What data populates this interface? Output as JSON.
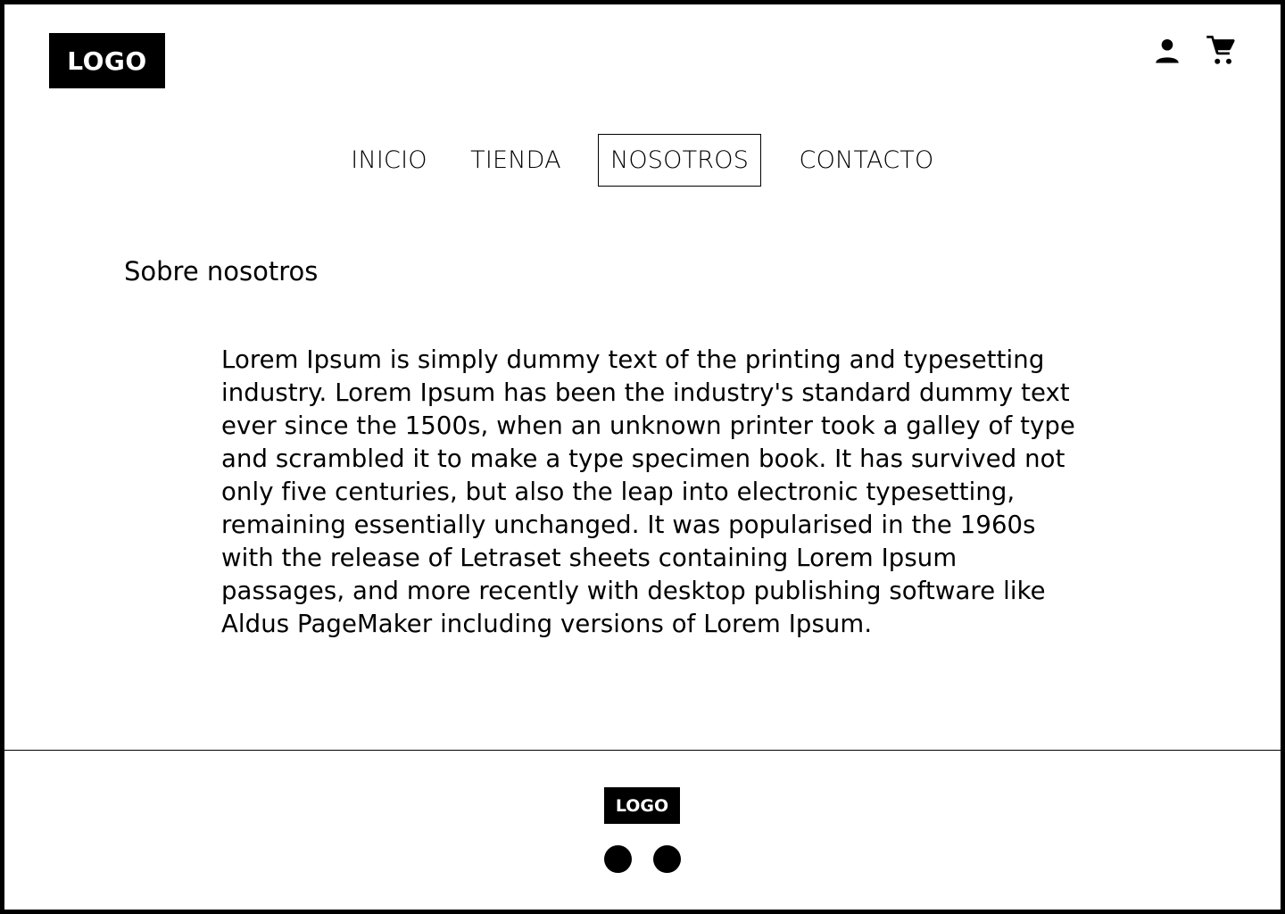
{
  "header": {
    "logo_text": "LOGO",
    "icons": [
      "user-icon",
      "cart-icon"
    ]
  },
  "nav": {
    "items": [
      {
        "label": "INICIO",
        "active": false
      },
      {
        "label": "TIENDA",
        "active": false
      },
      {
        "label": "NOSOTROS",
        "active": true
      },
      {
        "label": "CONTACTO",
        "active": false
      }
    ]
  },
  "main": {
    "title": "Sobre nosotros",
    "body": " Lorem Ipsum is simply dummy text of the printing and typesetting industry. Lorem Ipsum has been the industry's standard dummy text ever since the 1500s, when an unknown printer took a galley of type and scrambled it to make a type specimen book. It has survived not only five centuries, but also the leap into electronic typesetting, remaining essentially unchanged. It was popularised in the 1960s with the release of Letraset sheets containing Lorem Ipsum passages, and more recently with desktop publishing software like Aldus PageMaker including versions of Lorem Ipsum."
  },
  "footer": {
    "logo_text": "LOGO",
    "social_icons": [
      "social-link-1",
      "social-link-2"
    ]
  },
  "colors": {
    "primary": "#000000",
    "background": "#ffffff"
  }
}
